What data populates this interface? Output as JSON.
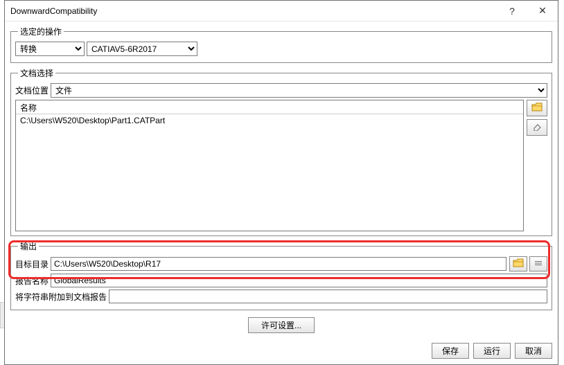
{
  "window": {
    "title": "DownwardCompatibility",
    "help": "?",
    "close": "✕"
  },
  "operation": {
    "legend": "选定的操作",
    "convert_label": "转换",
    "version": "CATIAV5-6R2017"
  },
  "docselect": {
    "legend": "文档选择",
    "location_label": "文档位置",
    "location_value": "文件",
    "column_name": "名称",
    "row0": "C:\\Users\\W520\\Desktop\\Part1.CATPart"
  },
  "output": {
    "legend": "输出",
    "target_label": "目标目录",
    "target_value": "C:\\Users\\W520\\Desktop\\R17",
    "report_label": "报告名称",
    "report_value": "GlobalResults",
    "append_label": "将字符串附加到文档报告",
    "append_value": ""
  },
  "license_btn": "许可设置...",
  "footer": {
    "save": "保存",
    "run": "运行",
    "cancel": "取消"
  }
}
